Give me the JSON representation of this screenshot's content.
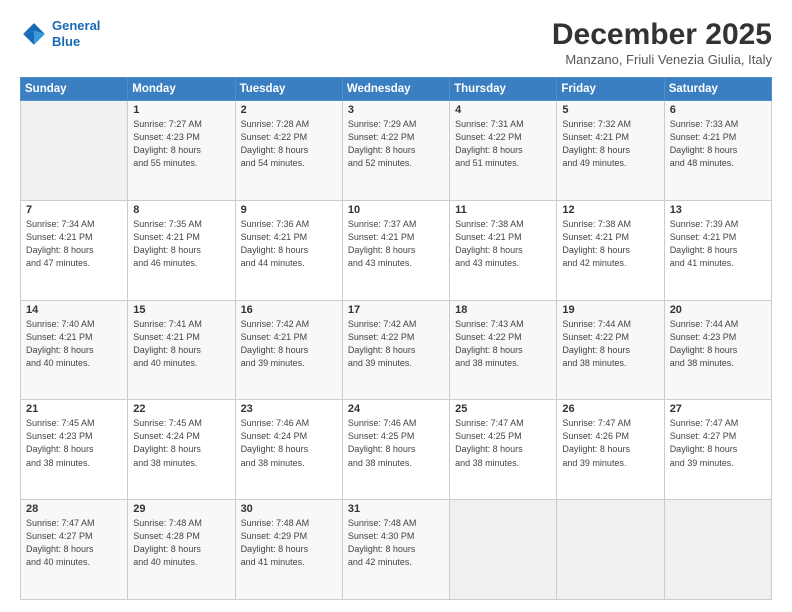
{
  "header": {
    "logo_line1": "General",
    "logo_line2": "Blue",
    "main_title": "December 2025",
    "subtitle": "Manzano, Friuli Venezia Giulia, Italy"
  },
  "days_of_week": [
    "Sunday",
    "Monday",
    "Tuesday",
    "Wednesday",
    "Thursday",
    "Friday",
    "Saturday"
  ],
  "weeks": [
    [
      {
        "day": "",
        "info": ""
      },
      {
        "day": "1",
        "info": "Sunrise: 7:27 AM\nSunset: 4:23 PM\nDaylight: 8 hours\nand 55 minutes."
      },
      {
        "day": "2",
        "info": "Sunrise: 7:28 AM\nSunset: 4:22 PM\nDaylight: 8 hours\nand 54 minutes."
      },
      {
        "day": "3",
        "info": "Sunrise: 7:29 AM\nSunset: 4:22 PM\nDaylight: 8 hours\nand 52 minutes."
      },
      {
        "day": "4",
        "info": "Sunrise: 7:31 AM\nSunset: 4:22 PM\nDaylight: 8 hours\nand 51 minutes."
      },
      {
        "day": "5",
        "info": "Sunrise: 7:32 AM\nSunset: 4:21 PM\nDaylight: 8 hours\nand 49 minutes."
      },
      {
        "day": "6",
        "info": "Sunrise: 7:33 AM\nSunset: 4:21 PM\nDaylight: 8 hours\nand 48 minutes."
      }
    ],
    [
      {
        "day": "7",
        "info": "Sunrise: 7:34 AM\nSunset: 4:21 PM\nDaylight: 8 hours\nand 47 minutes."
      },
      {
        "day": "8",
        "info": "Sunrise: 7:35 AM\nSunset: 4:21 PM\nDaylight: 8 hours\nand 46 minutes."
      },
      {
        "day": "9",
        "info": "Sunrise: 7:36 AM\nSunset: 4:21 PM\nDaylight: 8 hours\nand 44 minutes."
      },
      {
        "day": "10",
        "info": "Sunrise: 7:37 AM\nSunset: 4:21 PM\nDaylight: 8 hours\nand 43 minutes."
      },
      {
        "day": "11",
        "info": "Sunrise: 7:38 AM\nSunset: 4:21 PM\nDaylight: 8 hours\nand 43 minutes."
      },
      {
        "day": "12",
        "info": "Sunrise: 7:38 AM\nSunset: 4:21 PM\nDaylight: 8 hours\nand 42 minutes."
      },
      {
        "day": "13",
        "info": "Sunrise: 7:39 AM\nSunset: 4:21 PM\nDaylight: 8 hours\nand 41 minutes."
      }
    ],
    [
      {
        "day": "14",
        "info": "Sunrise: 7:40 AM\nSunset: 4:21 PM\nDaylight: 8 hours\nand 40 minutes."
      },
      {
        "day": "15",
        "info": "Sunrise: 7:41 AM\nSunset: 4:21 PM\nDaylight: 8 hours\nand 40 minutes."
      },
      {
        "day": "16",
        "info": "Sunrise: 7:42 AM\nSunset: 4:21 PM\nDaylight: 8 hours\nand 39 minutes."
      },
      {
        "day": "17",
        "info": "Sunrise: 7:42 AM\nSunset: 4:22 PM\nDaylight: 8 hours\nand 39 minutes."
      },
      {
        "day": "18",
        "info": "Sunrise: 7:43 AM\nSunset: 4:22 PM\nDaylight: 8 hours\nand 38 minutes."
      },
      {
        "day": "19",
        "info": "Sunrise: 7:44 AM\nSunset: 4:22 PM\nDaylight: 8 hours\nand 38 minutes."
      },
      {
        "day": "20",
        "info": "Sunrise: 7:44 AM\nSunset: 4:23 PM\nDaylight: 8 hours\nand 38 minutes."
      }
    ],
    [
      {
        "day": "21",
        "info": "Sunrise: 7:45 AM\nSunset: 4:23 PM\nDaylight: 8 hours\nand 38 minutes."
      },
      {
        "day": "22",
        "info": "Sunrise: 7:45 AM\nSunset: 4:24 PM\nDaylight: 8 hours\nand 38 minutes."
      },
      {
        "day": "23",
        "info": "Sunrise: 7:46 AM\nSunset: 4:24 PM\nDaylight: 8 hours\nand 38 minutes."
      },
      {
        "day": "24",
        "info": "Sunrise: 7:46 AM\nSunset: 4:25 PM\nDaylight: 8 hours\nand 38 minutes."
      },
      {
        "day": "25",
        "info": "Sunrise: 7:47 AM\nSunset: 4:25 PM\nDaylight: 8 hours\nand 38 minutes."
      },
      {
        "day": "26",
        "info": "Sunrise: 7:47 AM\nSunset: 4:26 PM\nDaylight: 8 hours\nand 39 minutes."
      },
      {
        "day": "27",
        "info": "Sunrise: 7:47 AM\nSunset: 4:27 PM\nDaylight: 8 hours\nand 39 minutes."
      }
    ],
    [
      {
        "day": "28",
        "info": "Sunrise: 7:47 AM\nSunset: 4:27 PM\nDaylight: 8 hours\nand 40 minutes."
      },
      {
        "day": "29",
        "info": "Sunrise: 7:48 AM\nSunset: 4:28 PM\nDaylight: 8 hours\nand 40 minutes."
      },
      {
        "day": "30",
        "info": "Sunrise: 7:48 AM\nSunset: 4:29 PM\nDaylight: 8 hours\nand 41 minutes."
      },
      {
        "day": "31",
        "info": "Sunrise: 7:48 AM\nSunset: 4:30 PM\nDaylight: 8 hours\nand 42 minutes."
      },
      {
        "day": "",
        "info": ""
      },
      {
        "day": "",
        "info": ""
      },
      {
        "day": "",
        "info": ""
      }
    ]
  ]
}
